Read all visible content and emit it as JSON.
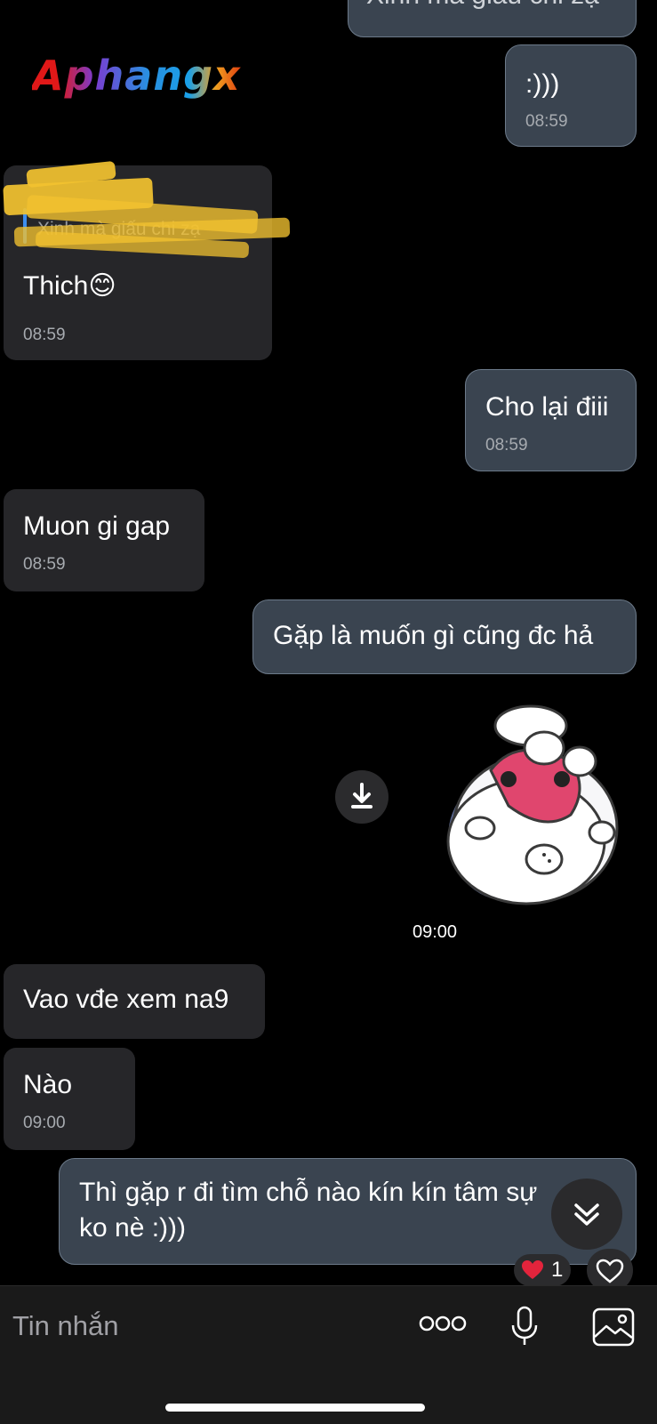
{
  "watermark": "Aphangx",
  "messages": {
    "top_partial": {
      "text": "Xinh mà giấu chi zạ"
    },
    "m1": {
      "text": ":)))",
      "time": "08:59"
    },
    "m2": {
      "quote": "Xinh mà giấu chi zạ",
      "text": "Thich",
      "emoji": "😊",
      "time": "08:59"
    },
    "m3": {
      "text": "Cho lại điii",
      "time": "08:59"
    },
    "m4": {
      "text": "Muon gi gap",
      "time": "08:59"
    },
    "m5": {
      "text": "Gặp là muốn gì cũng đc hả"
    },
    "sticker": {
      "time": "09:00",
      "icon": "sticker-seal"
    },
    "m6": {
      "text": "Vao vđe xem na9"
    },
    "m7": {
      "text": "Nào",
      "time": "09:00"
    },
    "m8": {
      "line1": "Thì gặp r đi tìm chỗ nào kín kín tâm sự",
      "line2": "ko nè :)))"
    }
  },
  "reactions": {
    "heart_count": "1"
  },
  "composer": {
    "placeholder": "Tin nhắn",
    "icons": [
      "more-icon",
      "microphone-icon",
      "image-icon"
    ]
  }
}
